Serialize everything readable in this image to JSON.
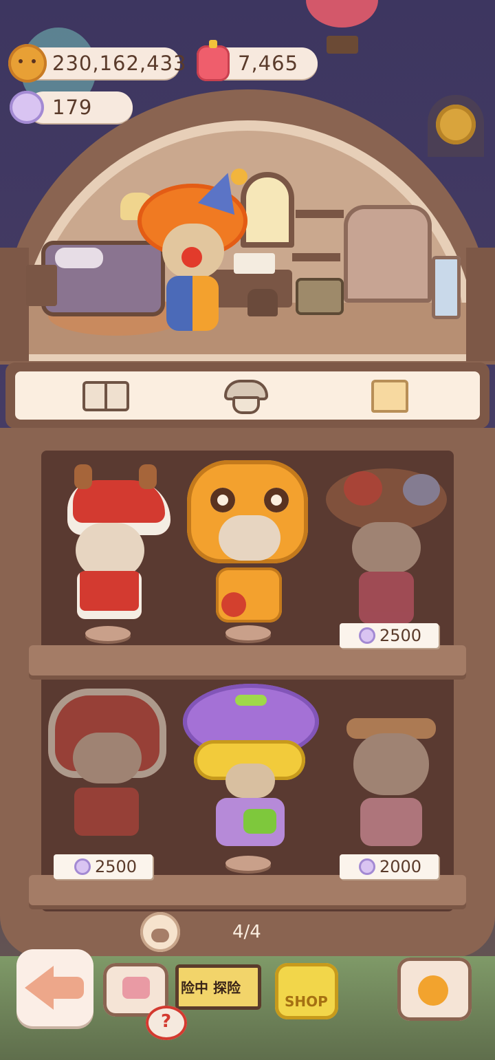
{
  "currencies": {
    "cookies": {
      "value": "230,162,433",
      "icon": "cookie-icon"
    },
    "jelly": {
      "value": "7,465",
      "icon": "jelly-icon"
    },
    "candy": {
      "value": "179",
      "icon": "candy-icon"
    }
  },
  "tabs": [
    {
      "icon": "book-icon"
    },
    {
      "icon": "mushroom-house-icon"
    },
    {
      "icon": "shirt-icon"
    }
  ],
  "costumes": [
    {
      "name": "christmas-reindeer-costume",
      "price": null,
      "locked": false
    },
    {
      "name": "tiger-costume",
      "price": null,
      "locked": false
    },
    {
      "name": "flower-costume",
      "price": "2500",
      "locked": true
    },
    {
      "name": "lion-dance-costume",
      "price": "2500",
      "locked": true
    },
    {
      "name": "tiger-purple-hat-costume",
      "price": null,
      "locked": false
    },
    {
      "name": "magical-girl-costume",
      "price": "2000",
      "locked": true
    }
  ],
  "pagination": {
    "label": "4/4"
  },
  "bottom_bar": {
    "sign_text": "险中 探险",
    "shop_text": "SHOP"
  },
  "colors": {
    "wood": "#8a6451",
    "cream": "#fbeee0",
    "night": "#3d3660"
  }
}
